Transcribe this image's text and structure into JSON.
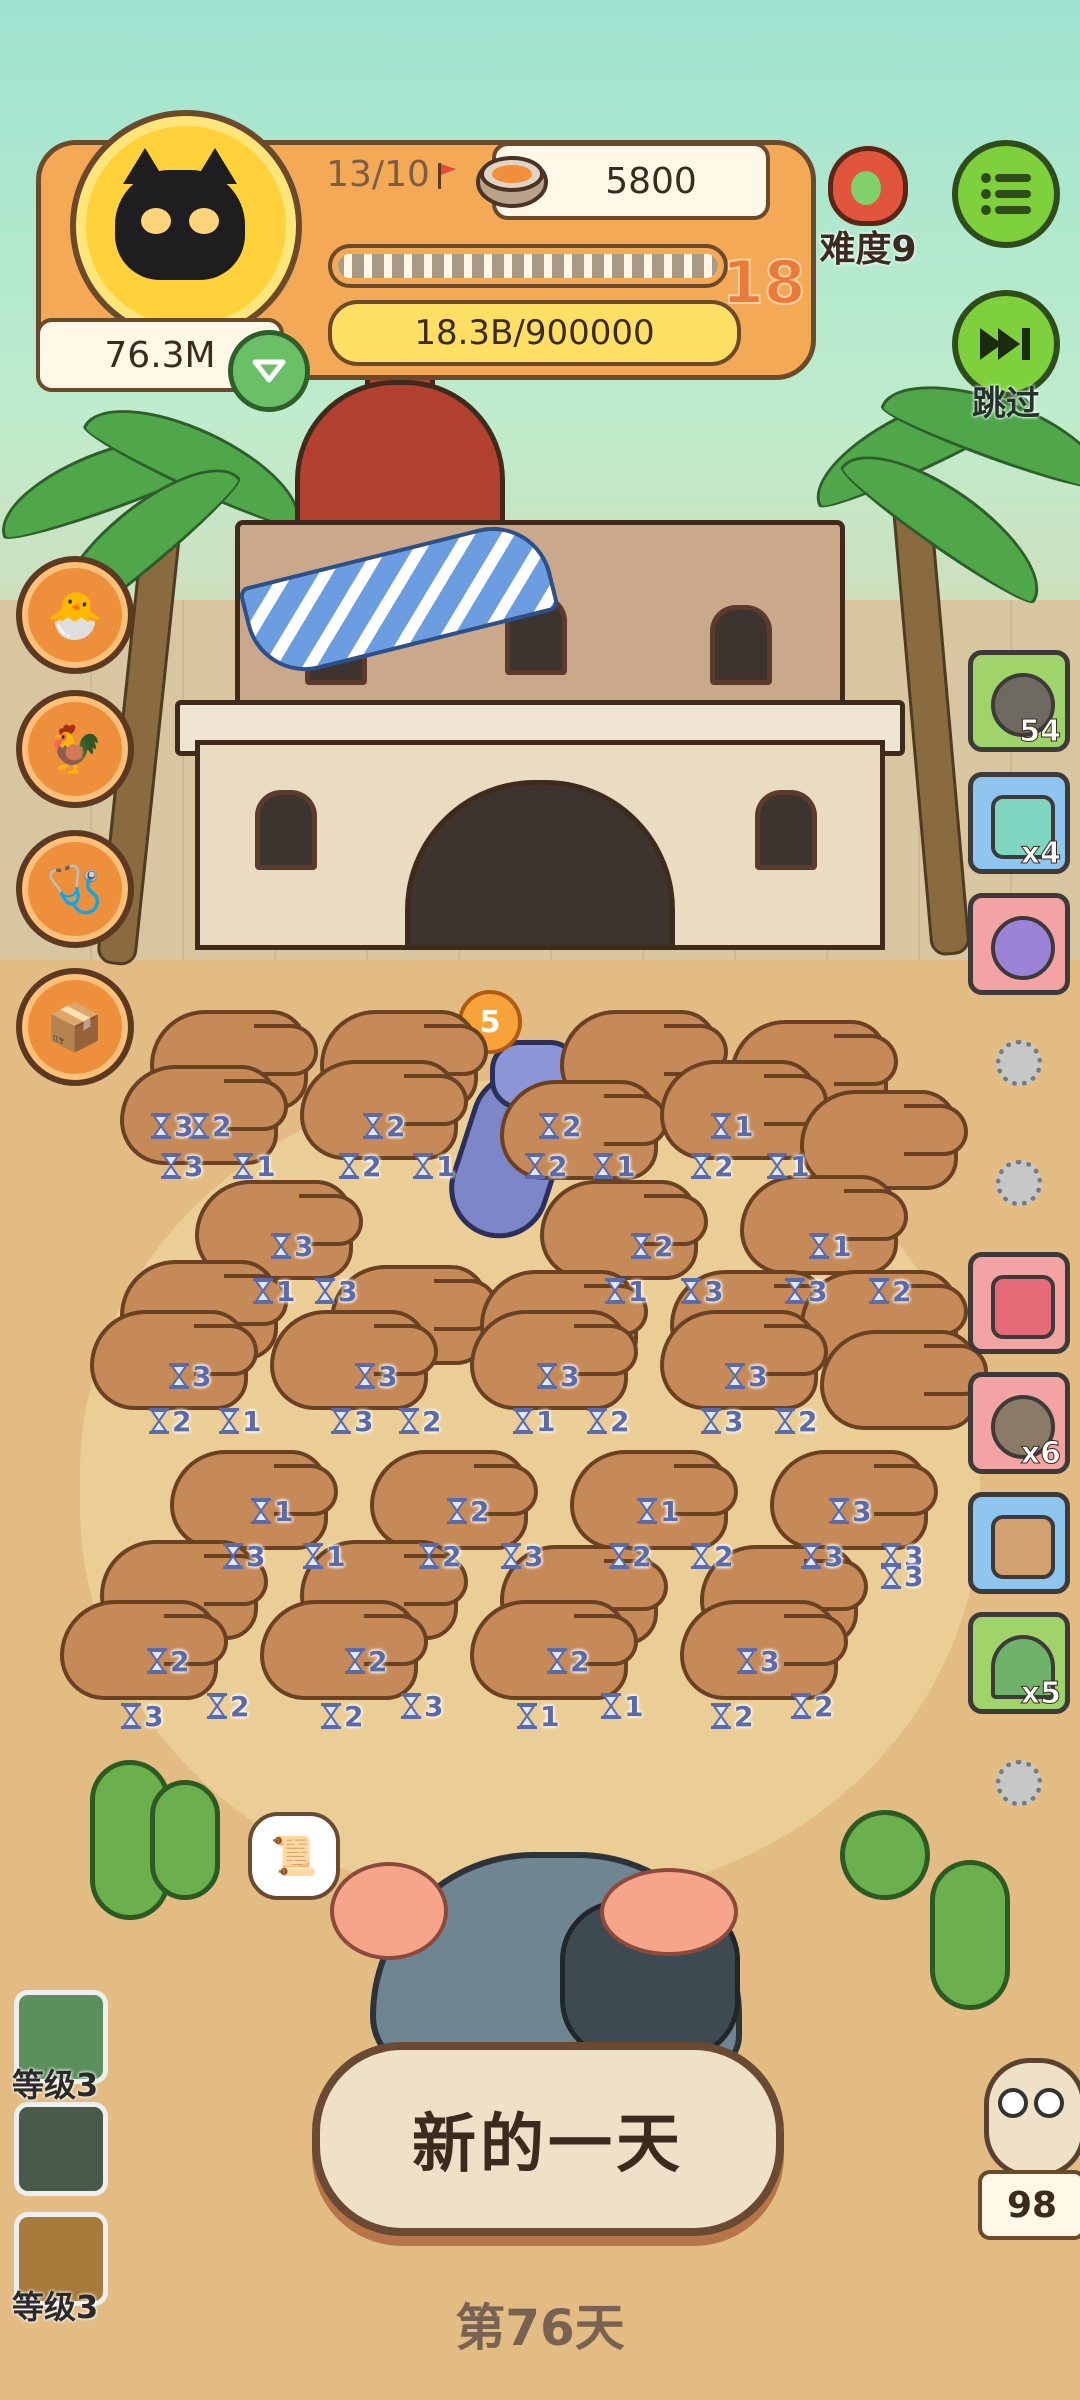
{
  "hud": {
    "wave_progress": "13/10",
    "coins": "5800",
    "cash": "76.3M",
    "xp_progress": "18.3B/900000",
    "big_number": "18",
    "difficulty": "难度9",
    "skip_label": "跳过"
  },
  "side_items": {
    "item1_count": "54",
    "item2_count": "x4",
    "item6_count": "x6",
    "item8_count": "x5"
  },
  "dragon_badge": "5",
  "badges": [
    "2",
    "3",
    "1",
    "2",
    "2",
    "1",
    "2",
    "2",
    "1",
    "1",
    "2",
    "1",
    "3",
    "1",
    "3",
    "2",
    "1",
    "3",
    "1",
    "3",
    "2",
    "3",
    "2",
    "1",
    "3",
    "3",
    "2",
    "3",
    "1",
    "2",
    "3",
    "3",
    "2",
    "1",
    "3",
    "1",
    "2",
    "3",
    "2",
    "1",
    "2",
    "2",
    "3",
    "3",
    "3",
    "2",
    "2",
    "3",
    "2",
    "3",
    "2",
    "2",
    "1",
    "1",
    "3",
    "2",
    "2",
    "3",
    "3"
  ],
  "bottom": {
    "level_label_1": "等级3",
    "level_label_2": "等级3",
    "new_day_button": "新的一天",
    "day_counter": "第76天",
    "owl_count": "98"
  },
  "icons": {
    "menu": "menu-icon",
    "skip": "fast-forward-icon",
    "shield": "chevron-down-icon",
    "coin": "coin-tin-icon",
    "flag": "flag-icon"
  },
  "colors": {
    "accent_orange": "#f3a955",
    "gold": "#ffe064",
    "green_button": "#7ed13d",
    "badge_blue": "#5b6aa8"
  }
}
